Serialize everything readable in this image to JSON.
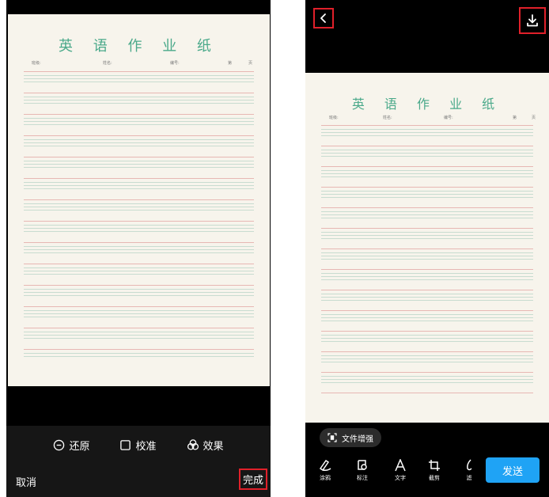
{
  "left": {
    "paper": {
      "title": "英 语 作 业 纸",
      "fields": [
        "班级:",
        "姓名:",
        "编号:",
        "第",
        "页"
      ]
    },
    "tools": [
      {
        "icon": "minus-circle-icon",
        "label": "还原"
      },
      {
        "icon": "square-outline-icon",
        "label": "校准"
      },
      {
        "icon": "effects-circles-icon",
        "label": "效果"
      }
    ],
    "cancel": "取消",
    "done": "完成"
  },
  "right": {
    "header": {
      "back_icon": "chevron-left-icon",
      "download_icon": "download-icon"
    },
    "paper": {
      "title": "英 语 作 业 纸",
      "fields": [
        "班级:",
        "姓名:",
        "编号:",
        "第",
        "页"
      ]
    },
    "enhance": {
      "icon": "document-scan-icon",
      "label": "文件增强"
    },
    "tools": [
      {
        "icon": "draw-pen-icon",
        "label": "涂鸦"
      },
      {
        "icon": "annotation-icon",
        "label": "标注"
      },
      {
        "icon": "text-a-icon",
        "label": "文字"
      },
      {
        "icon": "crop-icon",
        "label": "截剪"
      },
      {
        "icon": "filter-icon",
        "label": "滤"
      }
    ],
    "send": "发送"
  },
  "colors": {
    "highlight": "#e0202a",
    "send_button": "#1fa3f5",
    "paper_title": "#4aa98a"
  }
}
